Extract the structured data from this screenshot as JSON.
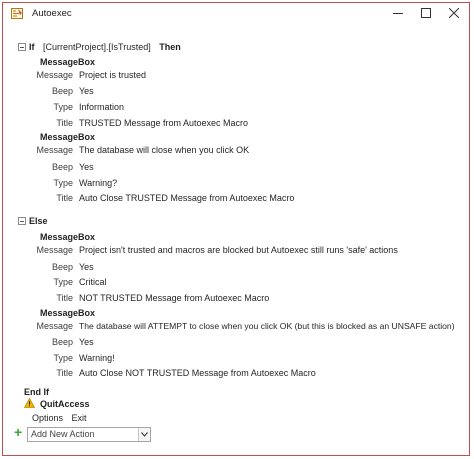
{
  "window": {
    "title": "Autoexec",
    "accent_color": "#c0504d"
  },
  "macro": {
    "if_keyword": "If",
    "if_condition": "[CurrentProject].[IsTrusted]",
    "then_keyword": "Then",
    "else_keyword": "Else",
    "end_if": "End If",
    "if_actions": [
      {
        "action": "MessageBox",
        "message_label": "Message",
        "message": "Project is trusted",
        "beep_label": "Beep",
        "beep": "Yes",
        "type_label": "Type",
        "type": "Information",
        "title_label": "Title",
        "title": "TRUSTED Message from Autoexec Macro"
      },
      {
        "action": "MessageBox",
        "message_label": "Message",
        "message": "The database will close when you click OK",
        "beep_label": "Beep",
        "beep": "Yes",
        "type_label": "Type",
        "type": "Warning?",
        "title_label": "Title",
        "title": "Auto Close TRUSTED Message from Autoexec Macro"
      }
    ],
    "else_actions": [
      {
        "action": "MessageBox",
        "message_label": "Message",
        "message": "Project isn't trusted and macros are blocked but Autoexec still runs 'safe' actions",
        "beep_label": "Beep",
        "beep": "Yes",
        "type_label": "Type",
        "type": "Critical",
        "title_label": "Title",
        "title": "NOT TRUSTED Message from Autoexec Macro"
      },
      {
        "action": "MessageBox",
        "message_label": "Message",
        "message": "The database will ATTEMPT to close when you click OK (but this is blocked as an UNSAFE action)",
        "beep_label": "Beep",
        "beep": "Yes",
        "type_label": "Type",
        "type": "Warning!",
        "title_label": "Title",
        "title": "Auto Close NOT TRUSTED Message from Autoexec Macro"
      }
    ],
    "quit_action": {
      "action": "QuitAccess",
      "options_label": "Options",
      "options_value": "Exit",
      "warning_icon": "warning-icon"
    },
    "add_new_action": {
      "placeholder": "Add New Action",
      "plus_icon": "plus-icon",
      "dropdown_icon": "chevron-down-icon"
    }
  }
}
